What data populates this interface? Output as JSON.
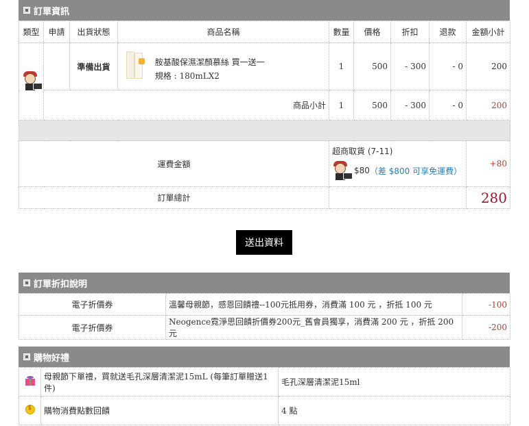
{
  "order_info": {
    "title": "訂單資訊",
    "headers": [
      "類型",
      "申請",
      "出貨狀態",
      "商品名稱",
      "數量",
      "價格",
      "折扣",
      "退款",
      "金額小計"
    ],
    "item": {
      "status": "準備出貨",
      "name": "胺基酸保濕潔顏慕絲 買一送一",
      "spec": "規格 : 180mLX2",
      "qty": "1",
      "price": "500",
      "discount": "- 300",
      "refund": "- 0",
      "subtotal": "200"
    },
    "subtotal_row": {
      "label": "商品小計",
      "qty": "1",
      "price": "500",
      "discount": "- 300",
      "refund": "- 0",
      "subtotal": "200"
    },
    "shipping": {
      "label": "運費金額",
      "method": "超商取貨 (7-11)",
      "fee": "$80",
      "note": "（差 $800 可享免運費）",
      "amount": "+80"
    },
    "total": {
      "label": "訂單總計",
      "amount": "280"
    }
  },
  "submit_label": "送出資料",
  "discount_info": {
    "title": "訂單折扣說明",
    "rows": [
      {
        "type": "電子折價券",
        "desc": "溫馨母親節，感恩回饋禮--100元抵用券，消費滿 100 元 ，折抵 100 元",
        "amount": "-100"
      },
      {
        "type": "電子折價券",
        "desc": "Neogence霓淨思回饋折價券200元_舊會員獨享，消費滿 200 元 ，折抵 200 元",
        "amount": "-200"
      }
    ]
  },
  "gifts": {
    "title": "購物好禮",
    "rows": [
      {
        "icon": "gift-icon",
        "desc": "母親節下單禮，買就送毛孔深層清潔泥15mL (每筆訂單贈送1件)",
        "value": "毛孔深層清潔泥15ml"
      },
      {
        "icon": "coin-icon",
        "desc": "購物消費點數回饋",
        "value": "4 點"
      }
    ]
  }
}
